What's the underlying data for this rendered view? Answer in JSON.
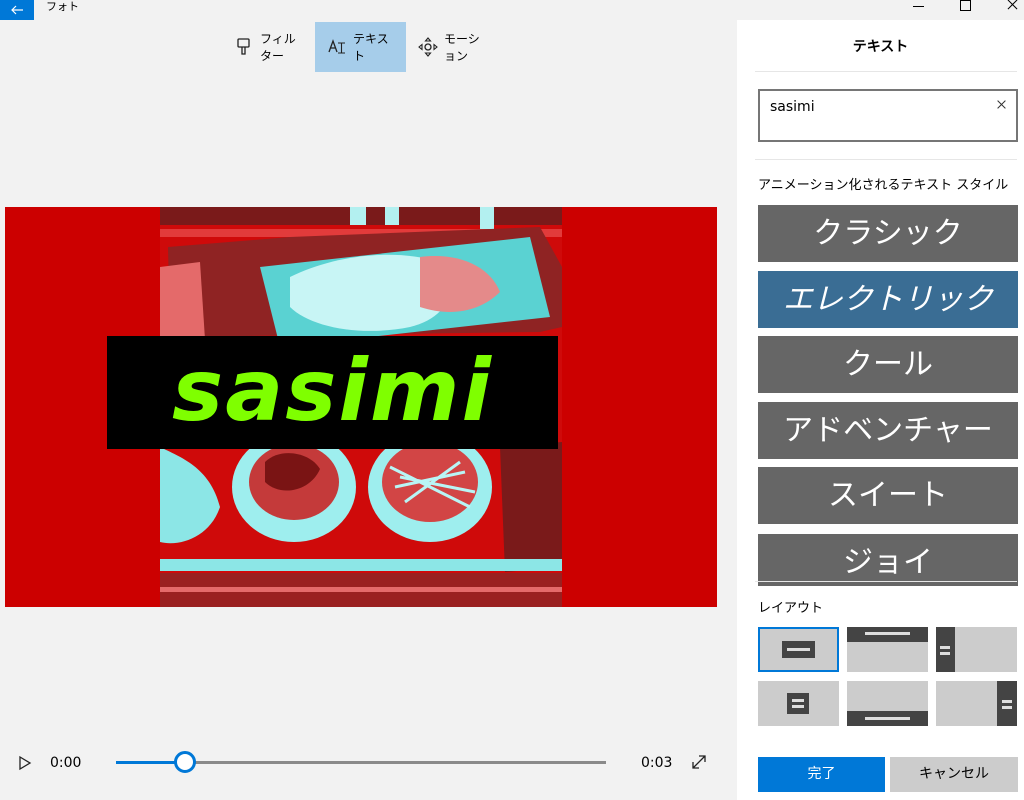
{
  "window": {
    "app_title": "フォト",
    "back_icon": "arrow-left-icon",
    "controls": [
      "minimize-icon",
      "maximize-icon",
      "close-icon"
    ]
  },
  "toolbar": {
    "items": [
      {
        "label": "フィルター",
        "icon": "filter-icon",
        "active": false
      },
      {
        "label": "テキスト",
        "icon": "text-icon",
        "active": true
      },
      {
        "label": "モーション",
        "icon": "motion-icon",
        "active": false
      }
    ],
    "active_color": "#a6cdea"
  },
  "preview": {
    "title_text": "sasimi",
    "text_color": "#7fff00",
    "background_color": "#cc0000",
    "text_box_color": "#000000"
  },
  "playback": {
    "current_time": "0:00",
    "total_time": "0:03",
    "progress_fraction": 0.14,
    "accent_color": "#0078d7"
  },
  "panel": {
    "title": "テキスト",
    "text_input_value": "sasimi",
    "styles_label": "アニメーション化されるテキスト スタイル",
    "styles": [
      {
        "label": "クラシック",
        "selected": false
      },
      {
        "label": "エレクトリック",
        "selected": true
      },
      {
        "label": "クール",
        "selected": false
      },
      {
        "label": "アドベンチャー",
        "selected": false
      },
      {
        "label": "スイート",
        "selected": false
      },
      {
        "label": "ジョイ",
        "selected": false
      }
    ],
    "layout_label": "レイアウト",
    "done_label": "完了",
    "cancel_label": "キャンセル",
    "selected_style_color": "#3a6d94",
    "style_color": "#666666"
  }
}
